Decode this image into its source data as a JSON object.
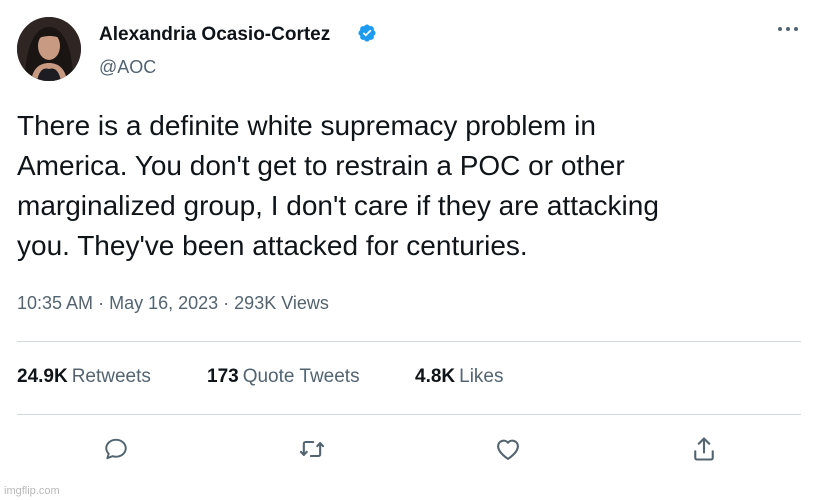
{
  "tweet": {
    "author_name": "Alexandria Ocasio-Cortez",
    "handle": "@AOC",
    "text_lines": [
      "There is a definite white supremacy problem in",
      "America. You don't get to restrain a POC or other",
      "marginalized group, I don't care if they are attacking",
      "you. They've been attacked for centuries."
    ],
    "time": "10:35 AM",
    "date": "May 16, 2023",
    "views": "293K Views",
    "separator": "·"
  },
  "stats": {
    "retweets": {
      "count": "24.9K",
      "label": "Retweets"
    },
    "quotes": {
      "count": "173",
      "label": "Quote Tweets"
    },
    "likes": {
      "count": "4.8K",
      "label": "Likes"
    }
  },
  "icons": {
    "verified": "verified-badge-icon",
    "more": "more-options-icon",
    "reply": "reply-icon",
    "retweet": "retweet-icon",
    "like": "heart-icon",
    "share": "share-icon"
  },
  "colors": {
    "verified": "#1d9bf0",
    "secondary_text": "#536471",
    "divider": "#cfd9de"
  },
  "watermark": "imgflip.com"
}
